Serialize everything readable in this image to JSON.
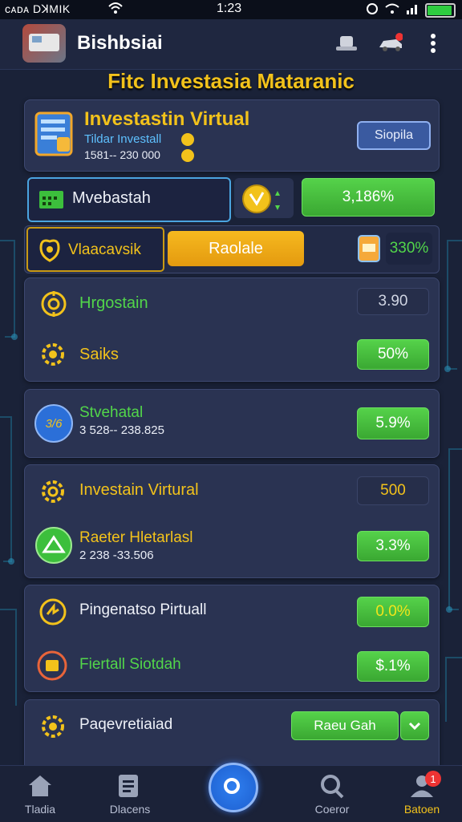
{
  "status_bar": {
    "left_text": "ᴄᴀᴅᴀ DꓘMIK",
    "time": "1:23"
  },
  "app_bar": {
    "title": "Bishbsiai"
  },
  "headline": "Fitc Investasia Mataranic",
  "hero": {
    "title": "Investastin Virtual",
    "subtitle": "Tildar Investall",
    "range": "1581-- 230 000",
    "button": "Siopila"
  },
  "field_row": {
    "input_label": "Mvebastah",
    "value": "3,186%"
  },
  "tab_row": {
    "tab_label": "Vlaacavsik",
    "button": "Raolale",
    "value": "330%"
  },
  "card1": {
    "row1": {
      "label": "Hrgostain",
      "value": "3.90"
    },
    "row2": {
      "label": "Saiks",
      "value": "50%"
    }
  },
  "card2": {
    "badge": "3/6",
    "title": "Stvehatal",
    "range": "3 528-- 238.825",
    "value": "5.9%"
  },
  "card3": {
    "row1": {
      "label": "Investain Virtural",
      "value": "500"
    },
    "row2": {
      "label": "Raeter Hletarlasl",
      "range": "2 238 -33.506",
      "value": "3.3%"
    }
  },
  "card4": {
    "row1": {
      "label": "Pingenatso Pirtuall",
      "value": "0.0%"
    },
    "row2": {
      "label": "Fiertall Siotdah",
      "value": "$.1%"
    }
  },
  "card5": {
    "label": "Paqevretiaiad",
    "button": "Raeu Gah"
  },
  "bottom_nav": {
    "items": [
      {
        "label": "Tladia"
      },
      {
        "label": "Dlacens"
      },
      {
        "label": "Coeror"
      },
      {
        "label": "Batoen"
      }
    ],
    "badge": "1"
  },
  "colors": {
    "accent_gold": "#f2c21b",
    "accent_green": "#52d64a",
    "background": "#1a2238"
  }
}
